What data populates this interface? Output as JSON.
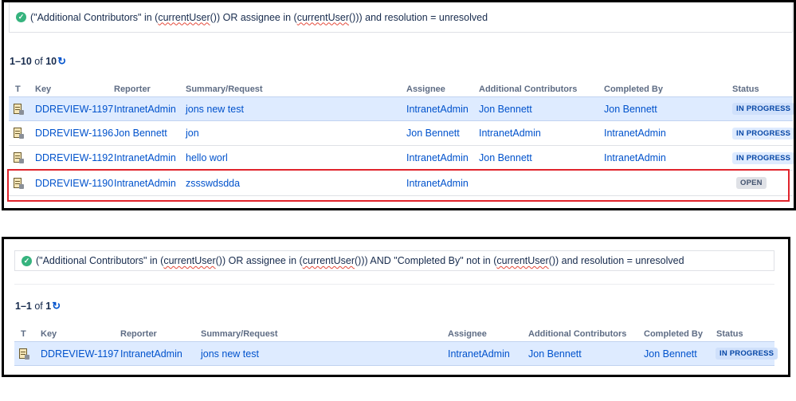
{
  "panel1": {
    "jql": {
      "p1": "(\"Additional Contributors\" in (",
      "fn1": "currentUser",
      "p2": "()) OR assignee in (",
      "fn2": "currentUser",
      "p3": "())) and resolution = unresolved"
    },
    "count": {
      "range": "1–10",
      "of": "of",
      "total": "10"
    },
    "columns": {
      "t": "T",
      "key": "Key",
      "reporter": "Reporter",
      "summary": "Summary/Request",
      "assignee": "Assignee",
      "contributors": "Additional Contributors",
      "completed": "Completed By",
      "status": "Status"
    },
    "rows": [
      {
        "key": "DDREVIEW-1197",
        "reporter": "IntranetAdmin",
        "summary": "jons new test",
        "assignee": "IntranetAdmin",
        "contributors": "Jon Bennett",
        "completed": "Jon Bennett",
        "status": "IN PROGRESS"
      },
      {
        "key": "DDREVIEW-1196",
        "reporter": "Jon Bennett",
        "summary": "jon",
        "assignee": "Jon Bennett",
        "contributors": "IntranetAdmin",
        "completed": "IntranetAdmin",
        "status": "IN PROGRESS"
      },
      {
        "key": "DDREVIEW-1192",
        "reporter": "IntranetAdmin",
        "summary": "hello worl",
        "assignee": "IntranetAdmin",
        "contributors": "Jon Bennett",
        "completed": "IntranetAdmin",
        "status": "IN PROGRESS"
      },
      {
        "key": "DDREVIEW-1190",
        "reporter": "IntranetAdmin",
        "summary": "zssswdsdda",
        "assignee": "IntranetAdmin",
        "contributors": "",
        "completed": "",
        "status": "OPEN"
      }
    ]
  },
  "panel2": {
    "jql": {
      "p1": "(\"Additional Contributors\" in (",
      "fn1": "currentUser",
      "p2": "()) OR assignee in (",
      "fn2": "currentUser",
      "p3": "())) AND \"Completed By\" not in (",
      "fn3": "currentUser",
      "p4": "()) and resolution = unresolved"
    },
    "count": {
      "range": "1–1",
      "of": "of",
      "total": "1"
    },
    "columns": {
      "t": "T",
      "key": "Key",
      "reporter": "Reporter",
      "summary": "Summary/Request",
      "assignee": "Assignee",
      "contributors": "Additional Contributors",
      "completed": "Completed By",
      "status": "Status"
    },
    "rows": [
      {
        "key": "DDREVIEW-1197",
        "reporter": "IntranetAdmin",
        "summary": "jons new test",
        "assignee": "IntranetAdmin",
        "contributors": "Jon Bennett",
        "completed": "Jon Bennett",
        "status": "IN PROGRESS"
      }
    ]
  },
  "colors": {
    "accent": "#0052cc",
    "success": "#36b37e",
    "highlight": "#e0242c"
  },
  "icons": {
    "check": "check-circle-icon",
    "refresh": "refresh-icon",
    "issue": "issue-type-icon"
  }
}
